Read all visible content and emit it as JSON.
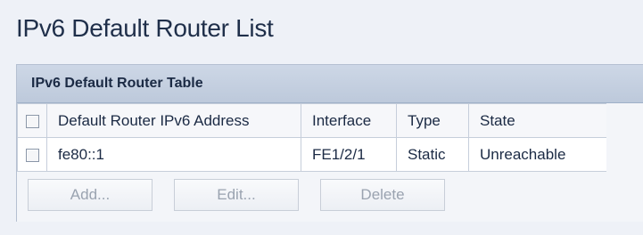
{
  "page_title": "IPv6 Default Router List",
  "table": {
    "title": "IPv6 Default Router Table",
    "columns": [
      "Default Router IPv6 Address",
      "Interface",
      "Type",
      "State"
    ],
    "rows": [
      {
        "address": "fe80::1",
        "interface": "FE1/2/1",
        "type": "Static",
        "state": "Unreachable"
      }
    ]
  },
  "buttons": {
    "add": "Add...",
    "edit": "Edit...",
    "delete": "Delete"
  }
}
